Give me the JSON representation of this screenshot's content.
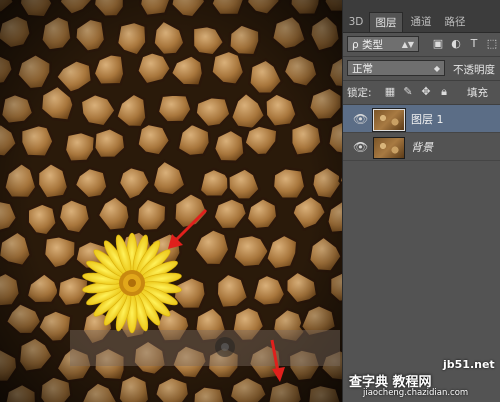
{
  "panel": {
    "tabs": [
      {
        "label": "3D"
      },
      {
        "label": "图层"
      },
      {
        "label": "通道"
      },
      {
        "label": "路径"
      }
    ],
    "filter": {
      "label": "ρ 类型"
    },
    "blend_mode": {
      "value": "正常"
    },
    "opacity_label": "不透明度",
    "lock_label": "锁定:",
    "fill_label": "填充",
    "layers": [
      {
        "name": "图层 1",
        "selected": true
      },
      {
        "name": "背景",
        "selected": false
      }
    ]
  },
  "watermark": {
    "site": "jb51.net",
    "brand": "查字典 教程网",
    "url": "jiaocheng.chazidian.com"
  },
  "colors": {
    "panel_bg": "#535353",
    "tab_bar_bg": "#3c3c3c",
    "selected_layer": "#5b6d86",
    "arrow_red": "#e0201c",
    "flower_yellow": "#f2d21a"
  }
}
